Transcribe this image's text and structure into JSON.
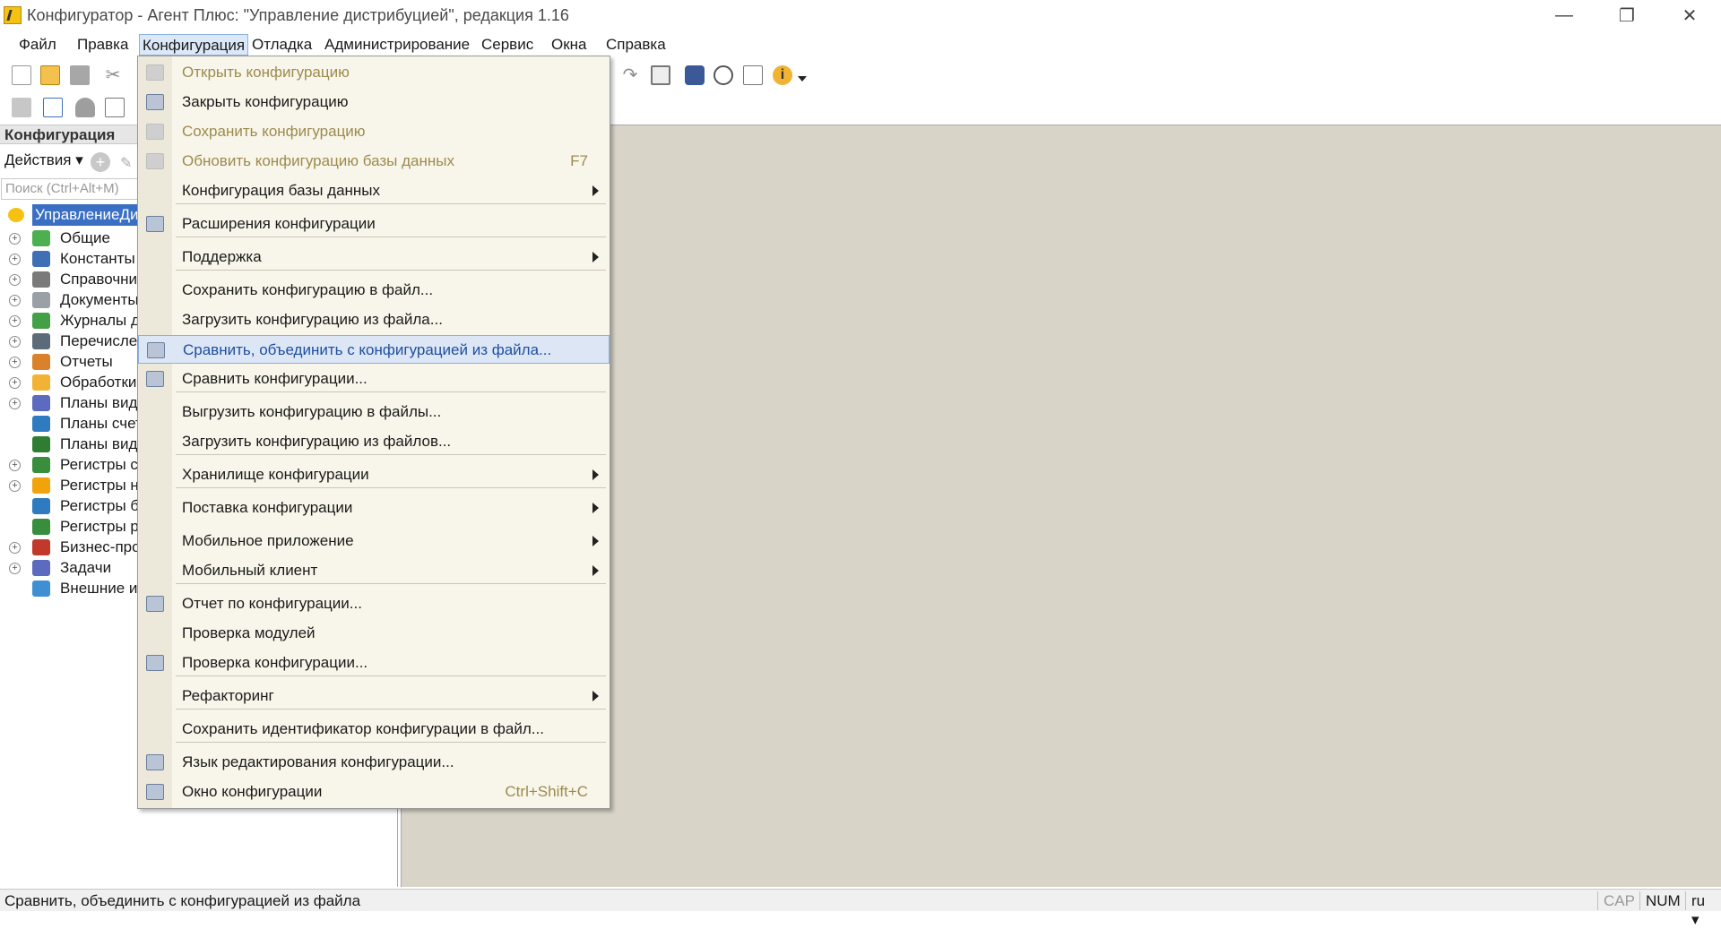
{
  "window": {
    "title": "Конфигуратор - Агент Плюс: \"Управление дистрибуцией\", редакция 1.16",
    "controls": {
      "minimize": "—",
      "restore": "❐",
      "close": "✕"
    }
  },
  "menubar": [
    {
      "label": "Файл"
    },
    {
      "label": "Правка"
    },
    {
      "label": "Конфигурация"
    },
    {
      "label": "Отладка"
    },
    {
      "label": "Администрирование"
    },
    {
      "label": "Сервис"
    },
    {
      "label": "Окна"
    },
    {
      "label": "Справка"
    }
  ],
  "panel": {
    "title": "Конфигурация",
    "actions_label": "Действия ▾",
    "search_placeholder": "Поиск (Ctrl+Alt+M)",
    "root_label": "УправлениеДи",
    "tree": [
      {
        "label": "Общие",
        "icon": "general-icon",
        "color": "#4caf50"
      },
      {
        "label": "Константы",
        "icon": "constants-icon",
        "color": "#3f6fb5"
      },
      {
        "label": "Справочни",
        "icon": "catalog-icon",
        "color": "#7a7a7a"
      },
      {
        "label": "Документы",
        "icon": "document-icon",
        "color": "#9aa0a6"
      },
      {
        "label": "Журналы до",
        "icon": "journal-icon",
        "color": "#43a047"
      },
      {
        "label": "Перечисле",
        "icon": "enum-icon",
        "color": "#5c6b7a"
      },
      {
        "label": "Отчеты",
        "icon": "report-icon",
        "color": "#d9822b"
      },
      {
        "label": "Обработки",
        "icon": "processing-icon",
        "color": "#f2b233"
      },
      {
        "label": "Планы вид",
        "icon": "chart-of-characteristics-icon",
        "color": "#5c6bc0"
      },
      {
        "label": "Планы счет",
        "icon": "chart-of-accounts-icon",
        "color": "#2f7bbf"
      },
      {
        "label": "Планы вид",
        "icon": "calc-types-icon",
        "color": "#2e7d32"
      },
      {
        "label": "Регистры с",
        "icon": "info-register-icon",
        "color": "#388e3c"
      },
      {
        "label": "Регистры н",
        "icon": "accumulation-register-icon",
        "color": "#f0a30a"
      },
      {
        "label": "Регистры б",
        "icon": "accounting-register-icon",
        "color": "#2f7bbf"
      },
      {
        "label": "Регистры р",
        "icon": "calculation-register-icon",
        "color": "#388e3c"
      },
      {
        "label": "Бизнес-про",
        "icon": "business-process-icon",
        "color": "#c0392b"
      },
      {
        "label": "Задачи",
        "icon": "task-icon",
        "color": "#5c6bc0"
      },
      {
        "label": "Внешние ис",
        "icon": "external-source-icon",
        "color": "#3f8fd2"
      }
    ]
  },
  "dropdown": {
    "items": [
      {
        "label": "Открыть конфигурацию",
        "disabled": true,
        "icon": "open-config-icon"
      },
      {
        "label": "Закрыть конфигурацию",
        "icon": "close-config-icon"
      },
      {
        "label": "Сохранить конфигурацию",
        "disabled": true,
        "icon": "save-config-icon"
      },
      {
        "label": "Обновить конфигурацию базы данных",
        "disabled": true,
        "shortcut": "F7",
        "icon": "update-db-icon"
      },
      {
        "label": "Конфигурация базы данных",
        "submenu": true
      },
      {
        "label": "Расширения конфигурации",
        "icon": "extensions-icon"
      },
      {
        "label": "Поддержка",
        "submenu": true
      },
      {
        "label": "Сохранить конфигурацию в файл..."
      },
      {
        "label": "Загрузить конфигурацию из файла..."
      },
      {
        "label": "Сравнить, объединить с конфигурацией из файла...",
        "selected": true,
        "icon": "compare-merge-icon"
      },
      {
        "label": "Сравнить конфигурации...",
        "icon": "compare-icon"
      },
      {
        "label": "Выгрузить конфигурацию в файлы..."
      },
      {
        "label": "Загрузить конфигурацию из файлов..."
      },
      {
        "label": "Хранилище конфигурации",
        "submenu": true
      },
      {
        "label": "Поставка конфигурации",
        "submenu": true
      },
      {
        "label": "Мобильное приложение",
        "submenu": true
      },
      {
        "label": "Мобильный клиент",
        "submenu": true
      },
      {
        "label": "Отчет по конфигурации...",
        "icon": "config-report-icon"
      },
      {
        "label": "Проверка модулей"
      },
      {
        "label": "Проверка конфигурации...",
        "icon": "check-config-icon"
      },
      {
        "label": "Рефакторинг",
        "submenu": true
      },
      {
        "label": "Сохранить идентификатор конфигурации в файл..."
      },
      {
        "label": "Язык редактирования конфигурации...",
        "icon": "language-icon"
      },
      {
        "label": "Окно конфигурации",
        "shortcut": "Ctrl+Shift+C",
        "icon": "config-window-icon"
      }
    ]
  },
  "statusbar": {
    "text": "Сравнить, объединить с конфигурацией из файла",
    "cap": "CAP",
    "num": "NUM",
    "lang": "ru ▾"
  },
  "colors": {
    "workspace": "#d8d4c8",
    "menu_bg": "#f8f6ea",
    "selection": "#dce6f5",
    "tree_selection": "#3a6fc4",
    "disabled_text": "#9d8a4e"
  }
}
